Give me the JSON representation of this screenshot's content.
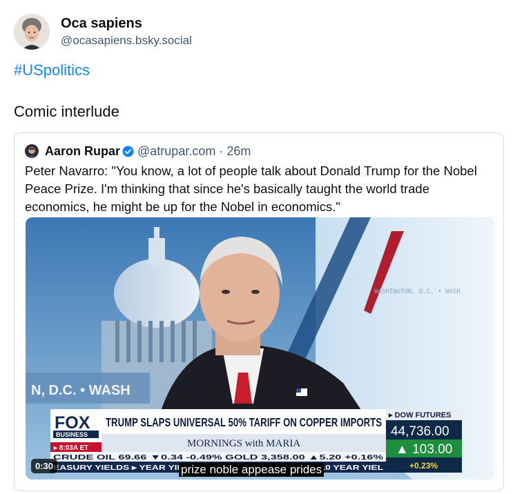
{
  "post": {
    "author_name": "Oca sapiens",
    "author_handle": "@ocasapiens.bsky.social",
    "hashtag": "#USpolitics",
    "text": "Comic interlude"
  },
  "quote": {
    "author_name": "Aaron Rupar",
    "author_handle": "@atrupar.com",
    "separator": "·",
    "time": "26m",
    "text": "Peter Navarro: \"You know, a lot of people talk about Donald Trump for the Nobel Peace Prize. I'm thinking that since he's basically taught the world trade economics, he might be up for the Nobel in economics.\""
  },
  "video": {
    "timestamp": "0:30",
    "caption": "prize noble appease prides",
    "wall_text": "WASHINGTON, D.C. • WASH",
    "left_wall_text": "N, D.C. • WASH",
    "network_logo": "FOX",
    "network_sub": "BUSINESS",
    "clock": "▸ 8:03A ET",
    "headline": "TRUMP SLAPS UNIVERSAL 50% TARIFF ON COPPER IMPORTS",
    "show_name": "MORNINGS with MARIA",
    "futures_label": "▸ DOW FUTURES",
    "futures_value": "44,736.00",
    "futures_change": "▲ 103.00",
    "futures_pct": "+0.23%",
    "ticker_row1": "CRUDE OIL      69.66  ▼0.34  -0.49%  GOLD        3,358.00  ▲5.20  +0.16%",
    "ticker_row2": "EASURY YIELDS ▸ YEAR YIELD  US 07   4.124%  ▼0.027  |  US 10 YEAR YIEL"
  },
  "colors": {
    "link": "#1083fe",
    "secondary_text": "#42576c",
    "verified": "#1083fe",
    "fox_red": "#c8102e",
    "futures_green": "#1e8e3e"
  },
  "icons": {
    "verified": "verified-check-icon"
  }
}
